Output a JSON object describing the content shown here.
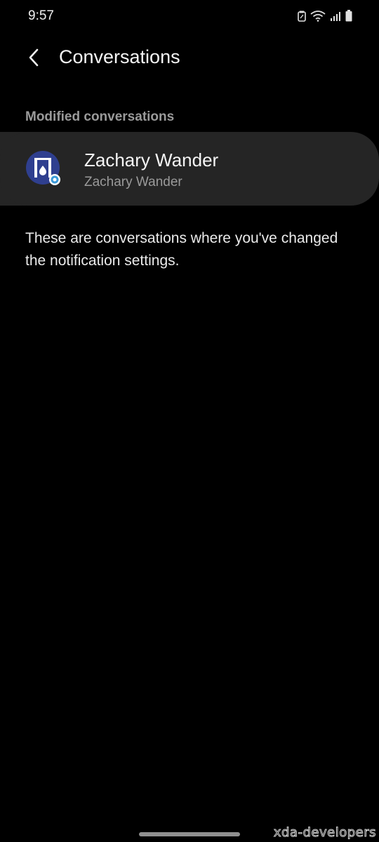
{
  "status_bar": {
    "time": "9:57",
    "icons": [
      "nfc-icon",
      "wifi-icon",
      "signal-icon",
      "battery-icon"
    ]
  },
  "header": {
    "back_icon": "chevron-left-icon",
    "title": "Conversations"
  },
  "section": {
    "header": "Modified conversations"
  },
  "conversation": {
    "name": "Zachary Wander",
    "subtitle": "Zachary Wander",
    "avatar_icon": "messaging-app-icon",
    "avatar_color": "#2f3f8f"
  },
  "description": "These are conversations where you've changed the notification settings.",
  "watermark": "xda-developers",
  "colors": {
    "background": "#000000",
    "card": "#252525",
    "secondary_text": "#9a9a9a"
  }
}
